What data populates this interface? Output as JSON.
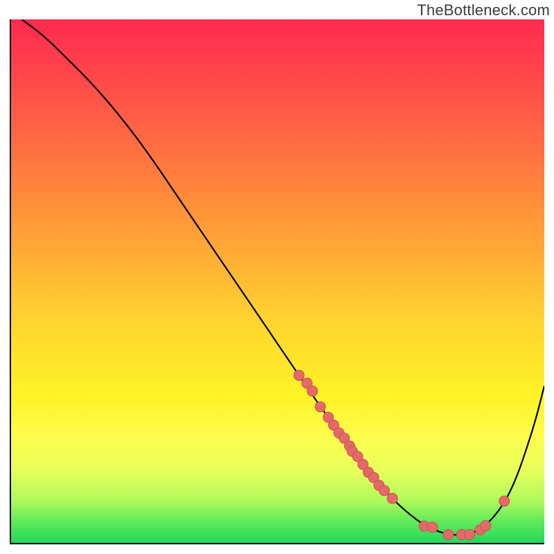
{
  "watermark": "TheBottleneck.com",
  "chart_data": {
    "type": "line",
    "title": "",
    "xlabel": "",
    "ylabel": "",
    "xlim": [
      0,
      100
    ],
    "ylim": [
      0,
      100
    ],
    "grid": false,
    "series": [
      {
        "name": "curve",
        "x": [
          2,
          6,
          10,
          14,
          18,
          22,
          26,
          30,
          34,
          38,
          42,
          46,
          50,
          54,
          58,
          62,
          66,
          70,
          74,
          78,
          82,
          86,
          90,
          94,
          98,
          100
        ],
        "y": [
          100,
          97,
          93,
          89,
          84.5,
          79.5,
          74,
          68,
          62,
          56,
          50,
          44,
          38,
          32,
          26,
          20.5,
          15,
          10,
          6,
          3,
          1.5,
          1.5,
          4,
          10,
          22,
          30
        ]
      }
    ],
    "markers": {
      "name": "highlight-points",
      "x": [
        54,
        55.5,
        56.5,
        58,
        59.5,
        60.5,
        61.5,
        62.5,
        63.5,
        64,
        65,
        66,
        67,
        68,
        69,
        70,
        71.5,
        77.5,
        79,
        82,
        84.5,
        86,
        88,
        89,
        92.5
      ],
      "y": [
        32,
        30.5,
        29,
        26,
        24,
        22.5,
        21,
        20,
        18.5,
        17.5,
        16.5,
        15,
        13.5,
        12.5,
        11,
        10,
        8.5,
        3.2,
        3,
        1.6,
        1.6,
        1.6,
        2.5,
        3.3,
        8
      ]
    }
  }
}
